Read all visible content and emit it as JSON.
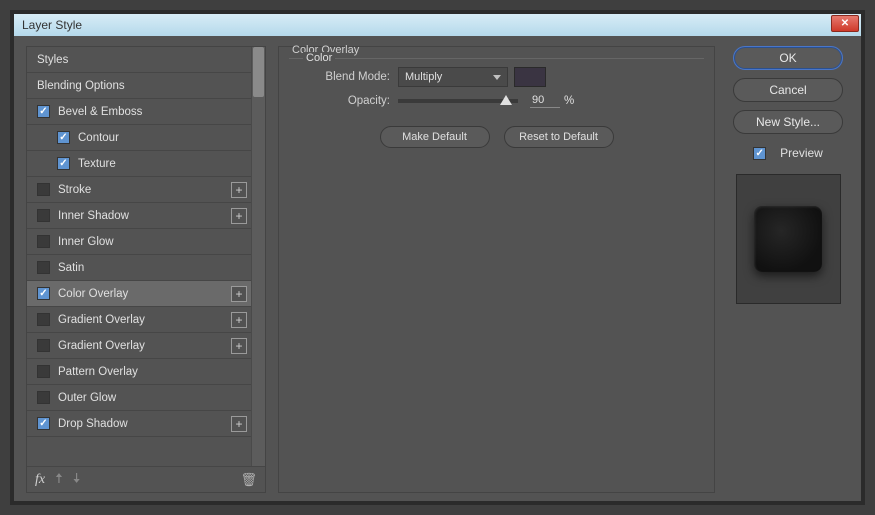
{
  "window": {
    "title": "Layer Style"
  },
  "styles": [
    {
      "label": "Styles",
      "hasCheck": false,
      "checked": false,
      "indent": false,
      "plus": false,
      "selected": false
    },
    {
      "label": "Blending Options",
      "hasCheck": false,
      "checked": false,
      "indent": false,
      "plus": false,
      "selected": false
    },
    {
      "label": "Bevel & Emboss",
      "hasCheck": true,
      "checked": true,
      "indent": false,
      "plus": false,
      "selected": false
    },
    {
      "label": "Contour",
      "hasCheck": true,
      "checked": true,
      "indent": true,
      "plus": false,
      "selected": false
    },
    {
      "label": "Texture",
      "hasCheck": true,
      "checked": true,
      "indent": true,
      "plus": false,
      "selected": false
    },
    {
      "label": "Stroke",
      "hasCheck": true,
      "checked": false,
      "indent": false,
      "plus": true,
      "selected": false
    },
    {
      "label": "Inner Shadow",
      "hasCheck": true,
      "checked": false,
      "indent": false,
      "plus": true,
      "selected": false
    },
    {
      "label": "Inner Glow",
      "hasCheck": true,
      "checked": false,
      "indent": false,
      "plus": false,
      "selected": false
    },
    {
      "label": "Satin",
      "hasCheck": true,
      "checked": false,
      "indent": false,
      "plus": false,
      "selected": false
    },
    {
      "label": "Color Overlay",
      "hasCheck": true,
      "checked": true,
      "indent": false,
      "plus": true,
      "selected": true
    },
    {
      "label": "Gradient Overlay",
      "hasCheck": true,
      "checked": false,
      "indent": false,
      "plus": true,
      "selected": false
    },
    {
      "label": "Gradient Overlay",
      "hasCheck": true,
      "checked": false,
      "indent": false,
      "plus": true,
      "selected": false
    },
    {
      "label": "Pattern Overlay",
      "hasCheck": true,
      "checked": false,
      "indent": false,
      "plus": false,
      "selected": false
    },
    {
      "label": "Outer Glow",
      "hasCheck": true,
      "checked": false,
      "indent": false,
      "plus": false,
      "selected": false
    },
    {
      "label": "Drop Shadow",
      "hasCheck": true,
      "checked": true,
      "indent": false,
      "plus": true,
      "selected": false
    }
  ],
  "center": {
    "section_title": "Color Overlay",
    "group_title": "Color",
    "blend_mode_label": "Blend Mode:",
    "blend_mode_value": "Multiply",
    "opacity_label": "Opacity:",
    "opacity_value": "90",
    "opacity_unit": "%",
    "make_default": "Make Default",
    "reset_default": "Reset to Default",
    "swatch_color": "#3a3442"
  },
  "right": {
    "ok": "OK",
    "cancel": "Cancel",
    "new_style": "New Style...",
    "preview": "Preview"
  },
  "fx_label": "fx"
}
